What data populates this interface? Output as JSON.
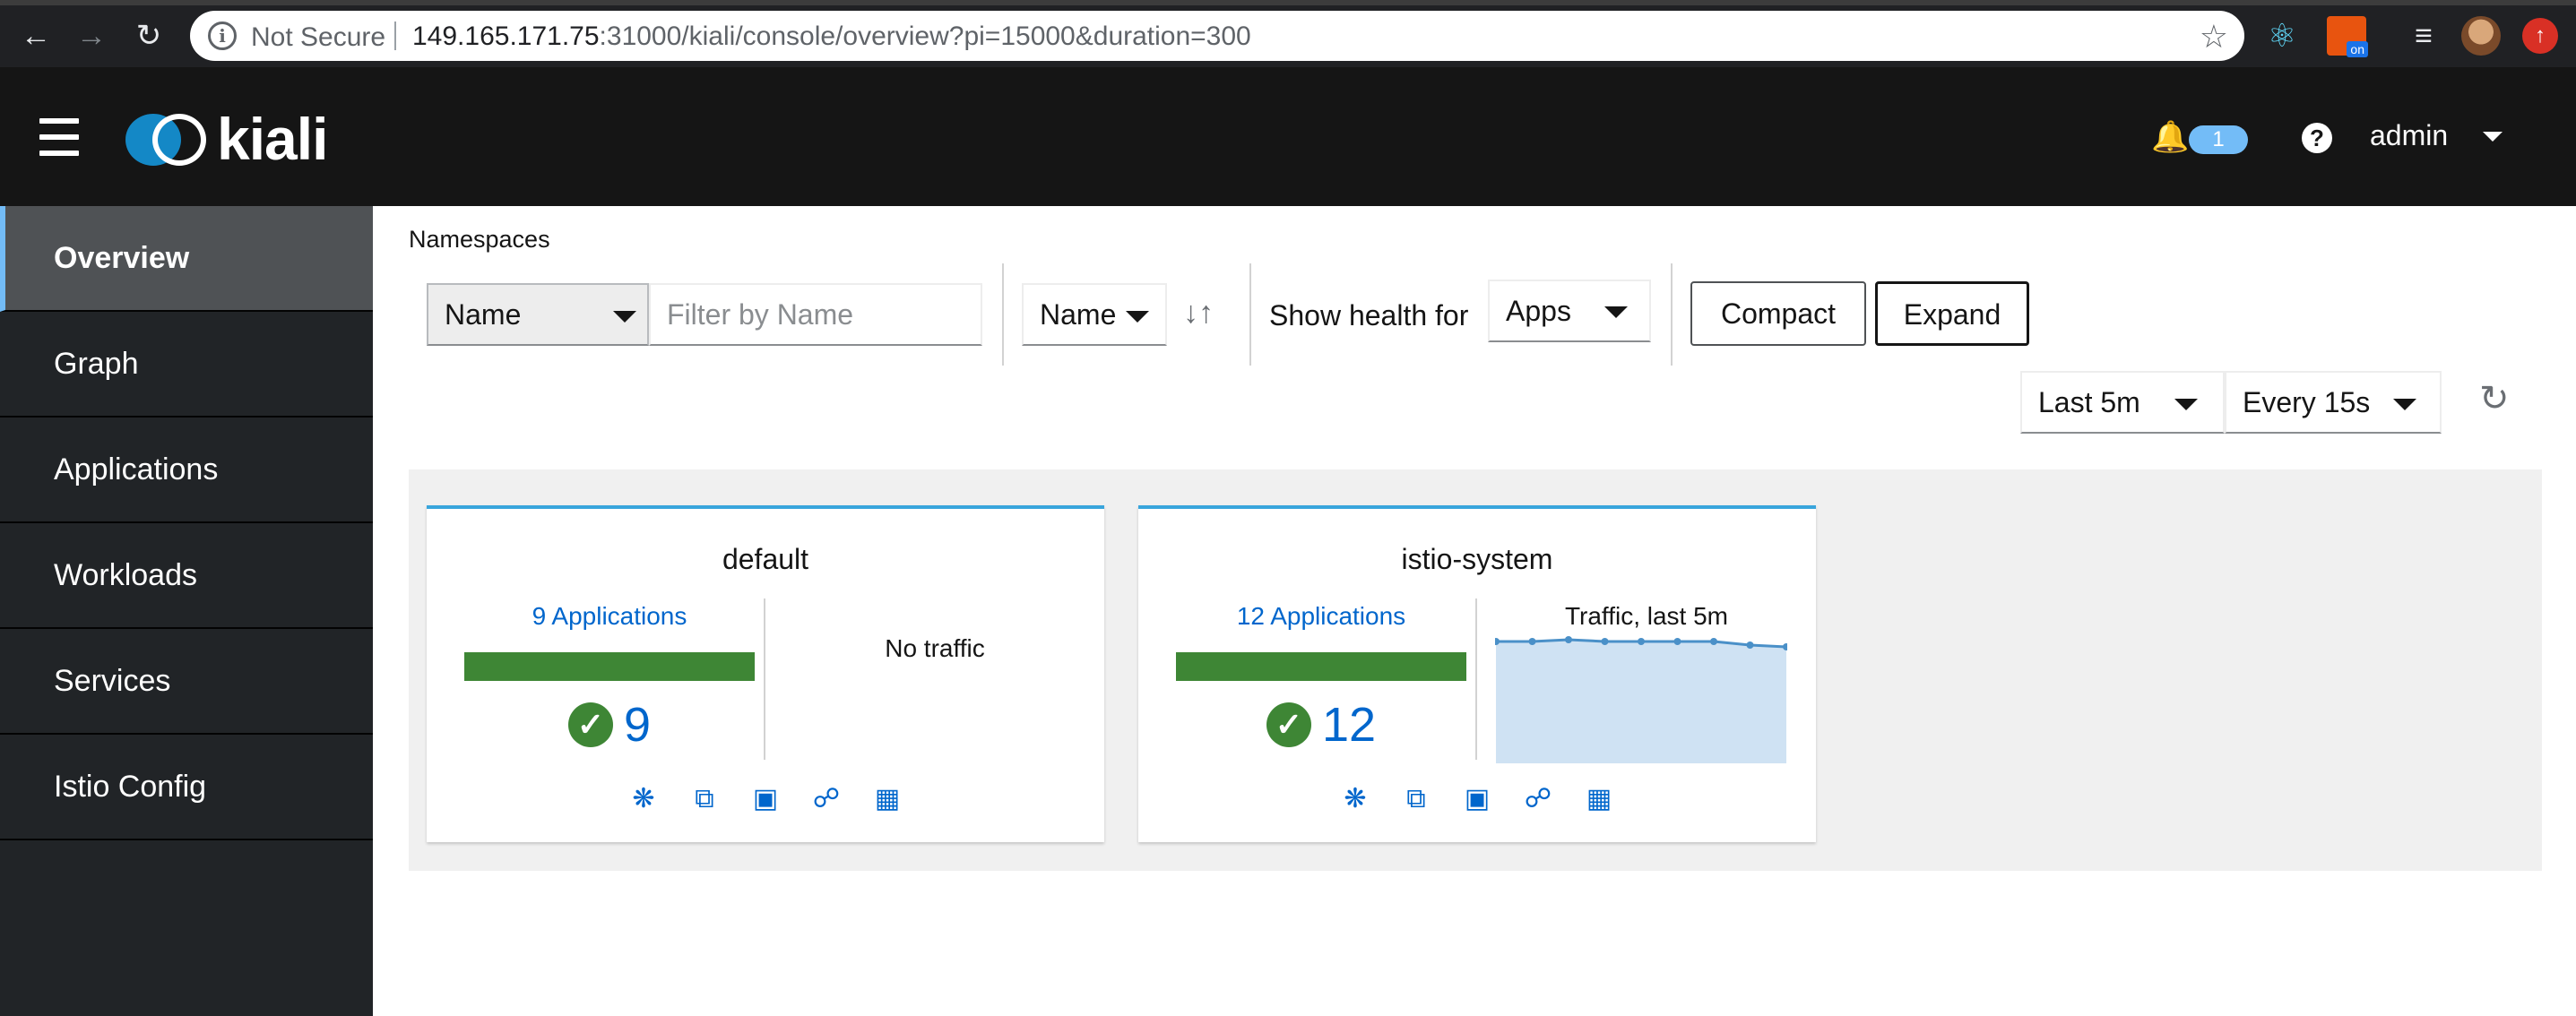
{
  "browser": {
    "back_icon": "arrow-left-icon",
    "forward_icon": "arrow-right-icon",
    "reload_icon": "reload-icon",
    "security_label": "Not Secure",
    "url_host": "149.165.171.75",
    "url_rest": ":31000/kiali/console/overview?pi=15000&duration=300",
    "extensions": [
      "react-devtools-icon",
      "on-extension-icon",
      "queue-icon",
      "profile-avatar",
      "update-icon"
    ]
  },
  "masthead": {
    "logo_text": "kiali",
    "notification_count": "1",
    "user": "admin",
    "accent": "#73bcf7"
  },
  "sidebar": {
    "items": [
      {
        "label": "Overview",
        "active": true
      },
      {
        "label": "Graph",
        "active": false
      },
      {
        "label": "Applications",
        "active": false
      },
      {
        "label": "Workloads",
        "active": false
      },
      {
        "label": "Services",
        "active": false
      },
      {
        "label": "Istio Config",
        "active": false
      }
    ]
  },
  "toolbar": {
    "section_title": "Namespaces",
    "filter_type": "Name",
    "filter_placeholder": "Filter by Name",
    "sort_field": "Name",
    "show_health_label": "Show health for",
    "health_for": "Apps",
    "compact_label": "Compact",
    "expand_label": "Expand",
    "time_range": "Last 5m",
    "refresh_interval": "Every 15s"
  },
  "namespaces": [
    {
      "name": "default",
      "applications_link": "9 Applications",
      "healthy_count": "9",
      "health_fraction": 1.0,
      "traffic_label": "No traffic",
      "health_color": "#3e8635"
    },
    {
      "name": "istio-system",
      "applications_link": "12 Applications",
      "healthy_count": "12",
      "health_fraction": 1.0,
      "traffic_label": "Traffic, last 5m",
      "sparkline": [
        0.98,
        0.98,
        0.99,
        0.98,
        0.98,
        0.98,
        0.98,
        0.96,
        0.95
      ],
      "health_color": "#3e8635"
    }
  ],
  "card_icons": [
    "topology-icon",
    "applications-icon",
    "workloads-icon",
    "services-icon",
    "istio-config-icon"
  ]
}
